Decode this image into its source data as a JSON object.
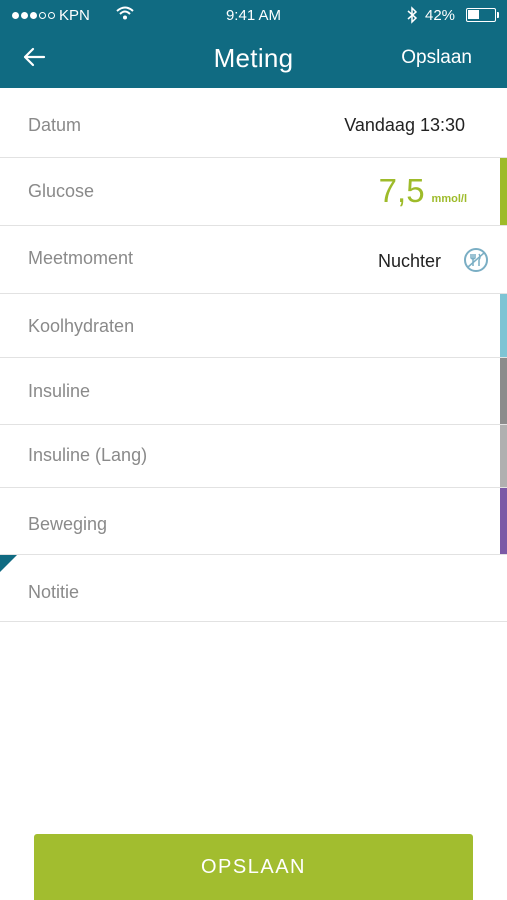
{
  "status_bar": {
    "carrier": "KPN",
    "time": "9:41 AM",
    "battery_text": "42%",
    "battery_level": 0.42
  },
  "nav": {
    "title": "Meting",
    "save_label": "Opslaan",
    "back_icon": "arrow-left-icon"
  },
  "rows": {
    "datum": {
      "label": "Datum",
      "value": "Vandaag 13:30"
    },
    "glucose": {
      "label": "Glucose",
      "value": "7,5",
      "unit": "mmol/l",
      "accent": "#9ebb2a"
    },
    "meetmoment": {
      "label": "Meetmoment",
      "value": "Nuchter",
      "icon": "fasting-icon"
    },
    "koolhydraten": {
      "label": "Koolhydraten",
      "accent": "#7ec4d4"
    },
    "insuline": {
      "label": "Insuline",
      "accent": "#8c8c8c"
    },
    "insuline_lang": {
      "label": "Insuline (Lang)",
      "accent": "#b0b0b0"
    },
    "beweging": {
      "label": "Beweging",
      "accent": "#7b5aa6"
    },
    "notitie": {
      "label": "Notitie"
    }
  },
  "save_button": {
    "label": "OPSLAAN"
  },
  "colors": {
    "header": "#106b82",
    "primary_green": "#a2bd2f"
  }
}
